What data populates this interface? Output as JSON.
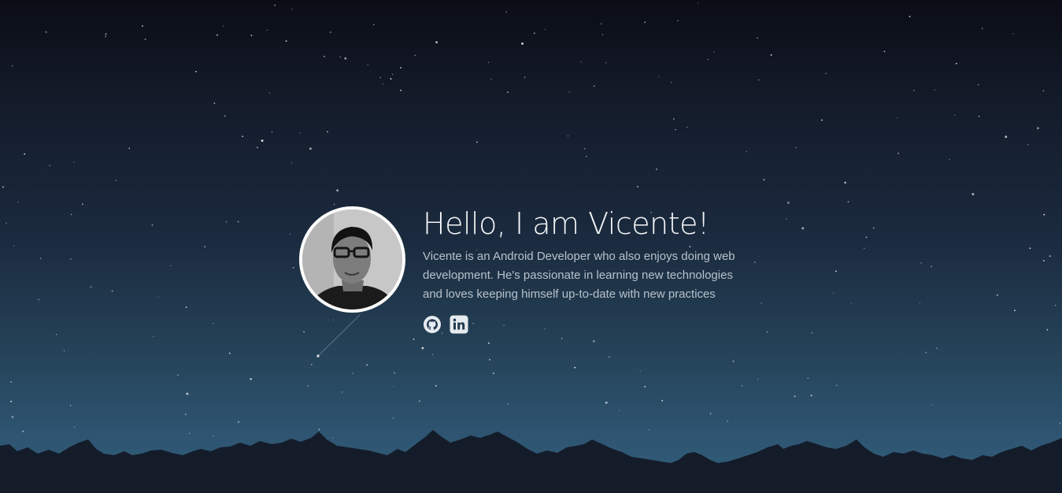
{
  "hero": {
    "heading": "Hello, I am Vicente!",
    "bio": "Vicente is an Android Developer who also enjoys doing web development. He's passionate in learning new technologies and loves keeping himself up-to-date with new practices"
  },
  "socials": [
    {
      "icon": "github-icon"
    },
    {
      "icon": "linkedin-icon"
    }
  ],
  "colors": {
    "sky_top": "#0b0d16",
    "sky_bottom": "#32607c",
    "mountains": "#141c2a",
    "heading": "#f4f6f8",
    "bio": "#b7c2cc",
    "icon": "#e6ebf0"
  }
}
